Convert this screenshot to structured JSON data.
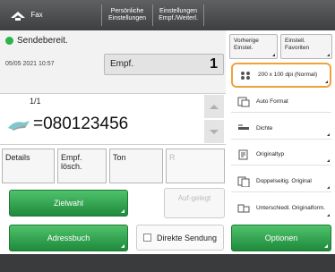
{
  "header": {
    "home_label": "Fax",
    "personal_settings": "Persönliche Einstellungen",
    "shared_settings": "Einstellungen Empf./Weiterl."
  },
  "status": {
    "text": "Sendebereit.",
    "datetime": "05/05 2021 10:57",
    "dest_label": "Empf.",
    "dest_count": "1"
  },
  "destination": {
    "page": "1/1",
    "number": "=080123456"
  },
  "controls": {
    "details": "Details",
    "remove": "Empf. lösch.",
    "tone": "Ton",
    "r": "R",
    "target": "Zielwahl",
    "on_hook": "Auf-gelegt",
    "address_book": "Adressbuch",
    "direct_send": "Direkte Sendung",
    "options": "Optionen"
  },
  "right_panel": {
    "previous_settings": "Vorherige Einstel.",
    "favorite_settings": "Einstell. Favoriten",
    "options": [
      {
        "icon": "resolution-icon",
        "label": "200 x 100 dpi (Normal)"
      },
      {
        "icon": "auto-format-icon",
        "label": "Auto Format"
      },
      {
        "icon": "density-icon",
        "label": "Dichte"
      },
      {
        "icon": "original-type-icon",
        "label": "Originaltyp"
      },
      {
        "icon": "duplex-original-icon",
        "label": "Doppelseitig. Original"
      },
      {
        "icon": "different-size-originals-icon",
        "label": "Unterschiedl. Originalform."
      }
    ]
  },
  "colors": {
    "accent_green": "#2db34a",
    "selected_outline": "#f0a23a"
  }
}
